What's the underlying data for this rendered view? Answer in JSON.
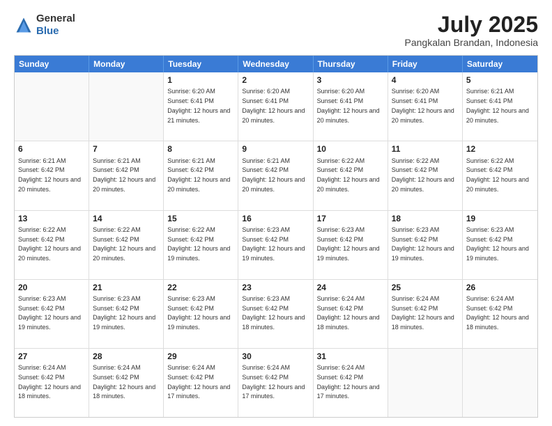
{
  "logo": {
    "general": "General",
    "blue": "Blue"
  },
  "header": {
    "title": "July 2025",
    "subtitle": "Pangkalan Brandan, Indonesia"
  },
  "days": [
    "Sunday",
    "Monday",
    "Tuesday",
    "Wednesday",
    "Thursday",
    "Friday",
    "Saturday"
  ],
  "weeks": [
    [
      {
        "day": "",
        "info": ""
      },
      {
        "day": "",
        "info": ""
      },
      {
        "day": "1",
        "info": "Sunrise: 6:20 AM\nSunset: 6:41 PM\nDaylight: 12 hours and 21 minutes."
      },
      {
        "day": "2",
        "info": "Sunrise: 6:20 AM\nSunset: 6:41 PM\nDaylight: 12 hours and 20 minutes."
      },
      {
        "day": "3",
        "info": "Sunrise: 6:20 AM\nSunset: 6:41 PM\nDaylight: 12 hours and 20 minutes."
      },
      {
        "day": "4",
        "info": "Sunrise: 6:20 AM\nSunset: 6:41 PM\nDaylight: 12 hours and 20 minutes."
      },
      {
        "day": "5",
        "info": "Sunrise: 6:21 AM\nSunset: 6:41 PM\nDaylight: 12 hours and 20 minutes."
      }
    ],
    [
      {
        "day": "6",
        "info": "Sunrise: 6:21 AM\nSunset: 6:42 PM\nDaylight: 12 hours and 20 minutes."
      },
      {
        "day": "7",
        "info": "Sunrise: 6:21 AM\nSunset: 6:42 PM\nDaylight: 12 hours and 20 minutes."
      },
      {
        "day": "8",
        "info": "Sunrise: 6:21 AM\nSunset: 6:42 PM\nDaylight: 12 hours and 20 minutes."
      },
      {
        "day": "9",
        "info": "Sunrise: 6:21 AM\nSunset: 6:42 PM\nDaylight: 12 hours and 20 minutes."
      },
      {
        "day": "10",
        "info": "Sunrise: 6:22 AM\nSunset: 6:42 PM\nDaylight: 12 hours and 20 minutes."
      },
      {
        "day": "11",
        "info": "Sunrise: 6:22 AM\nSunset: 6:42 PM\nDaylight: 12 hours and 20 minutes."
      },
      {
        "day": "12",
        "info": "Sunrise: 6:22 AM\nSunset: 6:42 PM\nDaylight: 12 hours and 20 minutes."
      }
    ],
    [
      {
        "day": "13",
        "info": "Sunrise: 6:22 AM\nSunset: 6:42 PM\nDaylight: 12 hours and 20 minutes."
      },
      {
        "day": "14",
        "info": "Sunrise: 6:22 AM\nSunset: 6:42 PM\nDaylight: 12 hours and 20 minutes."
      },
      {
        "day": "15",
        "info": "Sunrise: 6:22 AM\nSunset: 6:42 PM\nDaylight: 12 hours and 19 minutes."
      },
      {
        "day": "16",
        "info": "Sunrise: 6:23 AM\nSunset: 6:42 PM\nDaylight: 12 hours and 19 minutes."
      },
      {
        "day": "17",
        "info": "Sunrise: 6:23 AM\nSunset: 6:42 PM\nDaylight: 12 hours and 19 minutes."
      },
      {
        "day": "18",
        "info": "Sunrise: 6:23 AM\nSunset: 6:42 PM\nDaylight: 12 hours and 19 minutes."
      },
      {
        "day": "19",
        "info": "Sunrise: 6:23 AM\nSunset: 6:42 PM\nDaylight: 12 hours and 19 minutes."
      }
    ],
    [
      {
        "day": "20",
        "info": "Sunrise: 6:23 AM\nSunset: 6:42 PM\nDaylight: 12 hours and 19 minutes."
      },
      {
        "day": "21",
        "info": "Sunrise: 6:23 AM\nSunset: 6:42 PM\nDaylight: 12 hours and 19 minutes."
      },
      {
        "day": "22",
        "info": "Sunrise: 6:23 AM\nSunset: 6:42 PM\nDaylight: 12 hours and 19 minutes."
      },
      {
        "day": "23",
        "info": "Sunrise: 6:23 AM\nSunset: 6:42 PM\nDaylight: 12 hours and 18 minutes."
      },
      {
        "day": "24",
        "info": "Sunrise: 6:24 AM\nSunset: 6:42 PM\nDaylight: 12 hours and 18 minutes."
      },
      {
        "day": "25",
        "info": "Sunrise: 6:24 AM\nSunset: 6:42 PM\nDaylight: 12 hours and 18 minutes."
      },
      {
        "day": "26",
        "info": "Sunrise: 6:24 AM\nSunset: 6:42 PM\nDaylight: 12 hours and 18 minutes."
      }
    ],
    [
      {
        "day": "27",
        "info": "Sunrise: 6:24 AM\nSunset: 6:42 PM\nDaylight: 12 hours and 18 minutes."
      },
      {
        "day": "28",
        "info": "Sunrise: 6:24 AM\nSunset: 6:42 PM\nDaylight: 12 hours and 18 minutes."
      },
      {
        "day": "29",
        "info": "Sunrise: 6:24 AM\nSunset: 6:42 PM\nDaylight: 12 hours and 17 minutes."
      },
      {
        "day": "30",
        "info": "Sunrise: 6:24 AM\nSunset: 6:42 PM\nDaylight: 12 hours and 17 minutes."
      },
      {
        "day": "31",
        "info": "Sunrise: 6:24 AM\nSunset: 6:42 PM\nDaylight: 12 hours and 17 minutes."
      },
      {
        "day": "",
        "info": ""
      },
      {
        "day": "",
        "info": ""
      }
    ]
  ]
}
